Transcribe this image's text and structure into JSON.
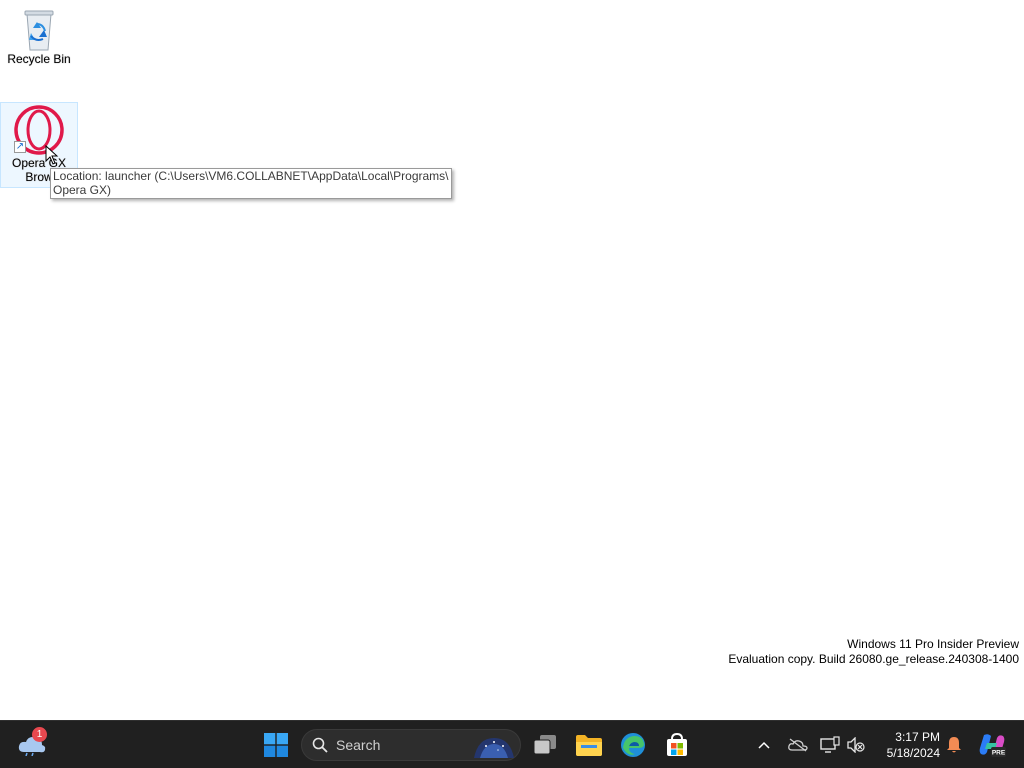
{
  "desktop": {
    "icons": [
      {
        "label": "Recycle Bin",
        "icon": "recycle-bin-icon"
      },
      {
        "label_line1": "Opera",
        "label_line1_suffix": " GX",
        "label_line2": "Brow",
        "icon": "opera-gx-icon",
        "shortcut": true
      }
    ],
    "tooltip": {
      "line1": "Location: launcher (C:\\Users\\VM6.COLLABNET\\AppData\\Local\\Programs\\",
      "line2": "Opera GX)"
    },
    "watermark": {
      "line1": "Windows 11 Pro Insider Preview",
      "line2": "Evaluation copy. Build 26080.ge_release.240308-1400"
    }
  },
  "taskbar": {
    "weather_badge": "1",
    "search_placeholder": "Search",
    "pinned": [
      "task-view-icon",
      "file-explorer-icon",
      "edge-icon",
      "microsoft-store-icon"
    ],
    "clock": {
      "time": "3:17 PM",
      "date": "5/18/2024"
    },
    "copilot_badge": "PRE"
  },
  "colors": {
    "taskbar_bg": "#202020",
    "accent_blue": "#0078d4",
    "opera_red": "#e0194a",
    "notification_orange": "#f28b54"
  }
}
